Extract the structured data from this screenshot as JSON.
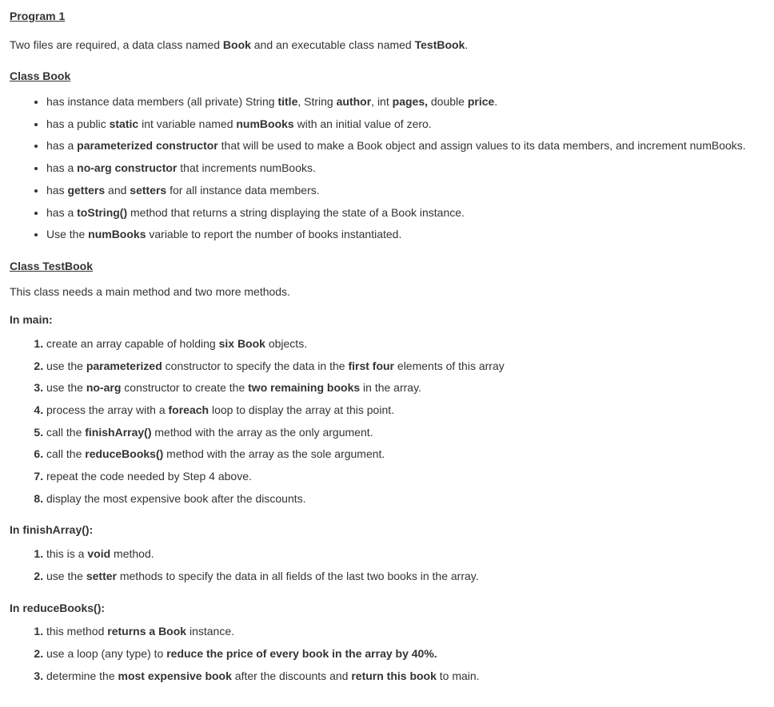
{
  "title": "Program 1",
  "intro": {
    "t1": "Two files are required, a data class named ",
    "b1": "Book",
    "t2": " and an executable class named ",
    "b2": "TestBook",
    "t3": "."
  },
  "classBook": {
    "heading": "Class Book",
    "items": {
      "i0": {
        "t1": "has instance data members (all private) String ",
        "b1": "title",
        "t2": ", String ",
        "b2": "author",
        "t3": ", int ",
        "b3": "pages,",
        "t4": " double ",
        "b4": "price",
        "t5": "."
      },
      "i1": {
        "t1": "has a public ",
        "b1": "static",
        "t2": " int variable named ",
        "b2": "numBooks",
        "t3": " with an initial value of zero."
      },
      "i2": {
        "t1": "has a ",
        "b1": "parameterized constructor",
        "t2": " that will be used to make a Book object and assign values to its data members, and increment numBooks."
      },
      "i3": {
        "t1": "has a ",
        "b1": "no-arg constructor",
        "t2": " that increments numBooks."
      },
      "i4": {
        "t1": "has ",
        "b1": "getters",
        "t2": " and ",
        "b2": "setters",
        "t3": " for all instance data members."
      },
      "i5": {
        "t1": "has a ",
        "b1": "toString()",
        "t2": " method that returns a string displaying the state of a Book instance."
      },
      "i6": {
        "t1": "Use the ",
        "b1": "numBooks",
        "t2": " variable to report the number of books instantiated."
      }
    }
  },
  "classTestBook": {
    "heading": "Class TestBook",
    "subtext": "This class needs a main method and two more methods.",
    "inMainLabel": "In main:",
    "inMain": {
      "s1": {
        "t1": "create an array capable of holding ",
        "b1": "six Book",
        "t2": " objects."
      },
      "s2": {
        "t1": "use the ",
        "b1": "parameterized",
        "t2": " constructor to specify the data in the ",
        "b2": "first four",
        "t3": " elements of this array"
      },
      "s3": {
        "t1": "use the ",
        "b1": "no-arg",
        "t2": " constructor to create the ",
        "b2": "two remaining books",
        "t3": " in the array."
      },
      "s4": {
        "t1": "process the array with a ",
        "b1": "foreach",
        "t2": " loop to display the array at this point."
      },
      "s5": {
        "t1": "call the ",
        "b1": "finishArray()",
        "t2": " method with the array as the only argument."
      },
      "s6": {
        "t1": "call the ",
        "b1": "reduceBooks()",
        "t2": " method with the array as the sole argument."
      },
      "s7": {
        "t1": "repeat the code needed by Step 4 above."
      },
      "s8": {
        "t1": "display the most expensive book after the discounts."
      }
    },
    "inFinishLabel": "In finishArray():",
    "inFinish": {
      "s1": {
        "t1": "this is a ",
        "b1": "void",
        "t2": " method."
      },
      "s2": {
        "t1": "use the ",
        "b1": "setter",
        "t2": " methods to specify the data in all fields of the last two books in the array."
      }
    },
    "inReduceLabel": "In reduceBooks():",
    "inReduce": {
      "s1": {
        "t1": "this method ",
        "b1": "returns a Book",
        "t2": " instance."
      },
      "s2": {
        "t1": "use a loop (any type) to ",
        "b1": "reduce the price of every book in the array by 40%."
      },
      "s3": {
        "t1": "determine the ",
        "b1": "most expensive book",
        "t2": " after the discounts and ",
        "b2": "return this book",
        "t3": " to main."
      }
    }
  }
}
